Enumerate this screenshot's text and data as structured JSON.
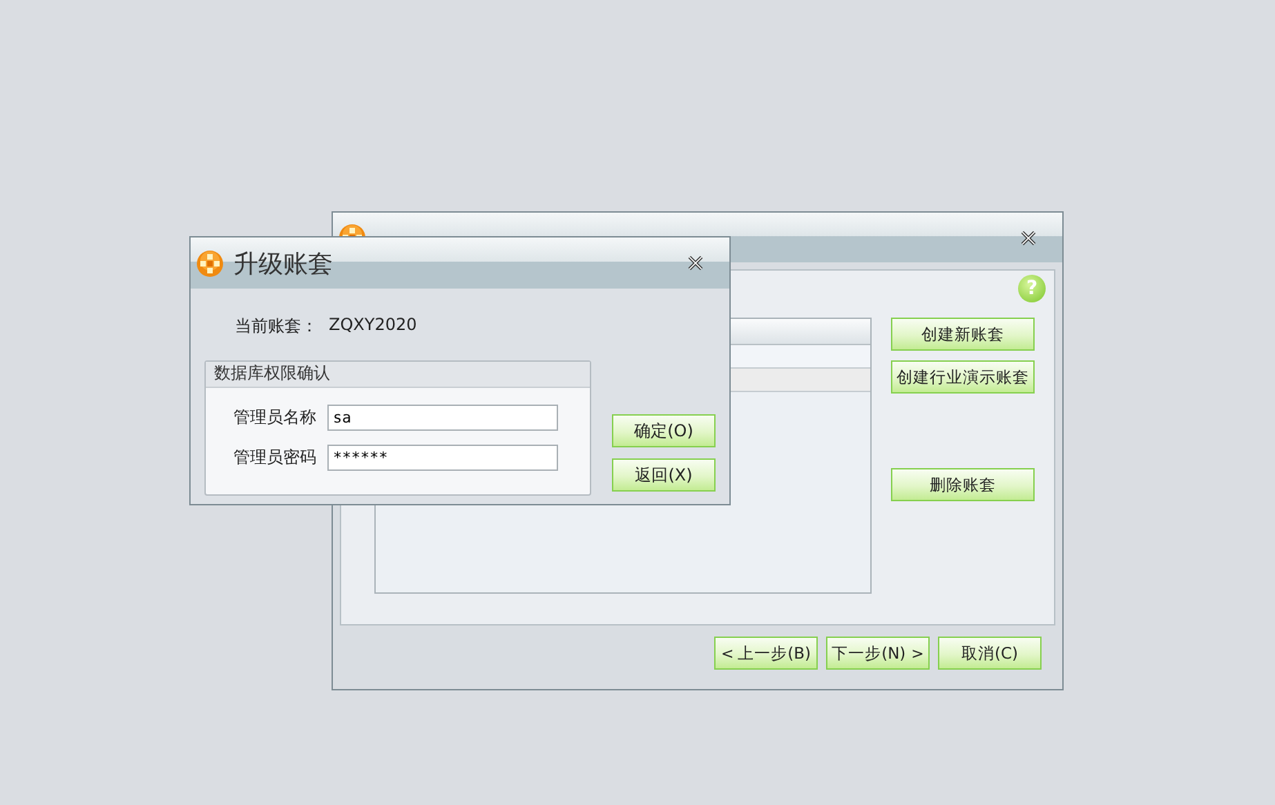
{
  "wizard_window": {
    "help": "?",
    "side_buttons": [
      "创建新账套",
      "创建行业演示账套",
      "删除账套"
    ],
    "nav_buttons": [
      {
        "label": "上一步(B)",
        "prefix": "<"
      },
      {
        "label": "下一步(N)",
        "suffix": ">"
      },
      {
        "label": "取消(C)"
      }
    ]
  },
  "dialog": {
    "title": "升级账套",
    "current_label": "当前账套：",
    "current_value": "ZQXY2020",
    "group_title": "数据库权限确认",
    "fields": [
      {
        "label": "管理员名称",
        "value": "sa"
      },
      {
        "label": "管理员密码",
        "value": "******"
      }
    ],
    "buttons": [
      "确定(O)",
      "返回(X)"
    ]
  }
}
